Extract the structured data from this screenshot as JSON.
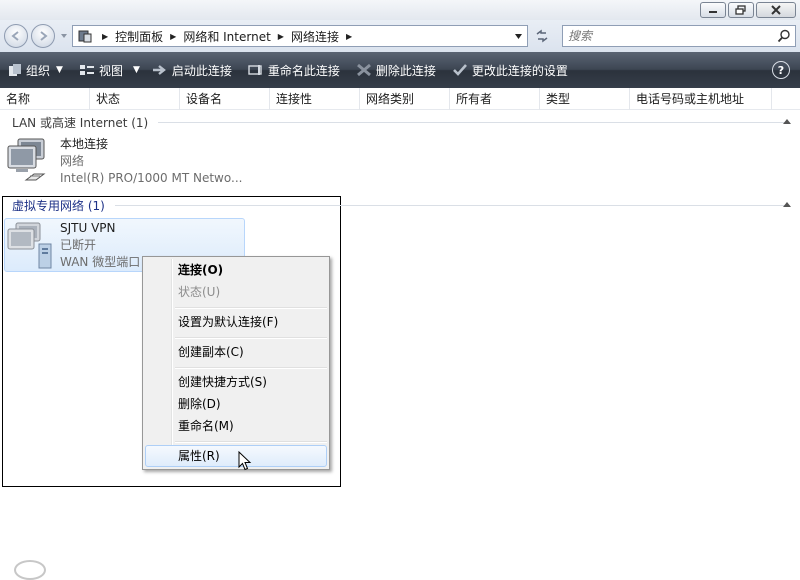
{
  "window": {
    "minimize_icon": "minimize-icon",
    "maximize_icon": "restore-icon",
    "close_icon": "close-icon"
  },
  "address_bar": {
    "breadcrumbs": [
      "控制面板",
      "网络和 Internet",
      "网络连接"
    ],
    "search_placeholder": "搜索"
  },
  "toolbar": {
    "organize": "组织",
    "view": "视图",
    "start_connection": "启动此连接",
    "rename_connection": "重命名此连接",
    "delete_connection": "删除此连接",
    "change_settings": "更改此连接的设置"
  },
  "columns": [
    "名称",
    "状态",
    "设备名",
    "连接性",
    "网络类别",
    "所有者",
    "类型",
    "电话号码或主机地址"
  ],
  "groups": {
    "lan": {
      "title": "LAN 或高速 Internet (1)",
      "item": {
        "name": "本地连接",
        "status": "网络",
        "device": "Intel(R) PRO/1000 MT Netwo..."
      }
    },
    "vpn": {
      "title": "虚拟专用网络 (1)",
      "item": {
        "name": "SJTU VPN",
        "status": "已断开",
        "device": "WAN 微型端口"
      }
    }
  },
  "context_menu": {
    "connect": "连接(O)",
    "status": "状态(U)",
    "set_default": "设置为默认连接(F)",
    "create_copy": "创建副本(C)",
    "create_shortcut": "创建快捷方式(S)",
    "delete": "删除(D)",
    "rename": "重命名(M)",
    "properties": "属性(R)"
  },
  "colors": {
    "toolbar_bg": "#3d4653",
    "group_title": "#1e3287",
    "selection_bg": "#dcebfc",
    "selection_border": "#b8d6fb"
  }
}
